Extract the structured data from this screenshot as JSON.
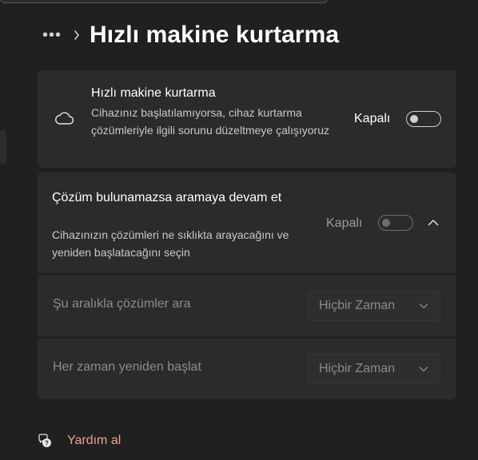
{
  "header": {
    "more_label": "•••",
    "title": "Hızlı makine kurtarma"
  },
  "main_card": {
    "icon": "cloud-icon",
    "title": "Hızlı makine kurtarma",
    "description": "Cihazınız başlatılamıyorsa, cihaz kurtarma çözümleriyle ilgili sorunu düzeltmeye çalışıyoruz",
    "toggle_label": "Kapalı",
    "toggle_state": "off"
  },
  "continue_card": {
    "title": "Çözüm bulunamazsa aramaya devam et",
    "description": "Cihazınızın çözümleri ne sıklıkta arayacağını ve yeniden başlatacağını seçin",
    "toggle_label": "Kapalı",
    "toggle_state": "off",
    "expanded": true,
    "disabled": true
  },
  "scan_interval": {
    "label": "Şu aralıkla çözümler ara",
    "selected": "Hiçbir Zaman"
  },
  "restart_interval": {
    "label": "Her zaman yeniden başlat",
    "selected": "Hiçbir Zaman"
  },
  "help": {
    "label": "Yardım al"
  },
  "colors": {
    "background": "#202020",
    "card": "#2b2b2b",
    "help_link": "#f0a090"
  }
}
